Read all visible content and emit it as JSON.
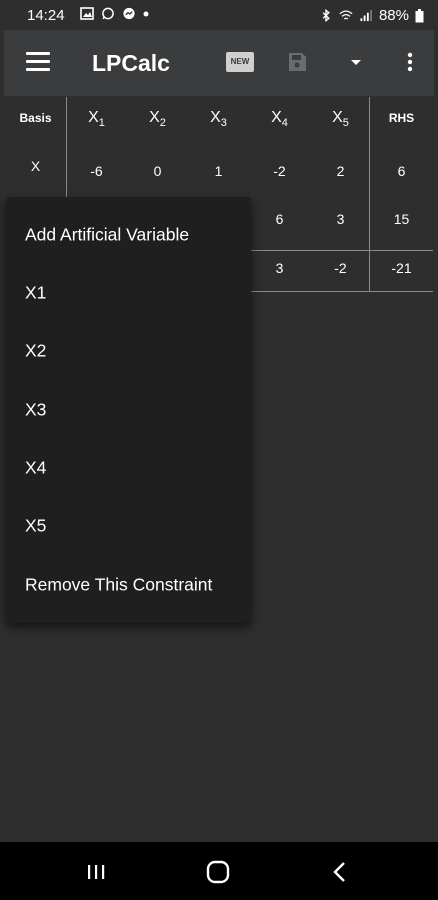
{
  "status_bar": {
    "time": "14:24",
    "battery": "88%",
    "left_icons": [
      "image-icon",
      "whatsapp-icon",
      "messenger-icon",
      "dot-icon"
    ],
    "right_icons": [
      "bluetooth-icon",
      "wifi-icon",
      "signal-icon",
      "battery-icon"
    ]
  },
  "app_bar": {
    "title": "LPCalc",
    "new_label": "NEW"
  },
  "tableau": {
    "basis_header": "Basis",
    "rhs_header": "RHS",
    "variable_headers": [
      {
        "name": "X",
        "sub": "1"
      },
      {
        "name": "X",
        "sub": "2"
      },
      {
        "name": "X",
        "sub": "3"
      },
      {
        "name": "X",
        "sub": "4"
      },
      {
        "name": "X",
        "sub": "5"
      }
    ],
    "rows": [
      {
        "basis": "X",
        "values": [
          "-6",
          "0",
          "1",
          "-2",
          "2"
        ],
        "rhs": "6"
      },
      {
        "basis": "",
        "values": [
          "",
          "",
          "",
          "6",
          "3"
        ],
        "rhs": "15"
      },
      {
        "basis": "",
        "values": [
          "",
          "",
          "",
          "3",
          "-2"
        ],
        "rhs": "-21"
      }
    ]
  },
  "context_menu": {
    "items": [
      "Add Artificial Variable",
      "X1",
      "X2",
      "X3",
      "X4",
      "X5",
      "Remove This Constraint"
    ]
  },
  "colors": {
    "background": "#2e2e2e",
    "app_bar": "#3a3c3e",
    "menu": "#1f1f1f",
    "nav_bar": "#000000"
  }
}
